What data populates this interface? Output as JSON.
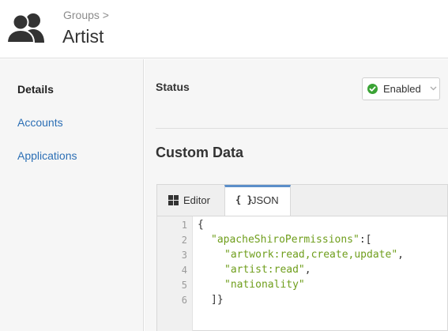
{
  "header": {
    "breadcrumb": "Groups >",
    "title": "Artist",
    "icon": "users-group-icon"
  },
  "sidebar": {
    "items": [
      {
        "label": "Details",
        "active": true
      },
      {
        "label": "Accounts",
        "active": false
      },
      {
        "label": "Applications",
        "active": false
      }
    ]
  },
  "status": {
    "label": "Status",
    "selected": "Enabled",
    "color": "#3aa335"
  },
  "custom_data": {
    "title": "Custom Data",
    "tabs": [
      {
        "label": "Editor",
        "icon": "grid-icon",
        "active": false
      },
      {
        "label": "JSON",
        "icon": "braces-icon",
        "active": true
      }
    ],
    "braces_glyph": "{ }",
    "code": {
      "line_numbers": [
        "1",
        "2",
        "3",
        "4",
        "5",
        "6"
      ],
      "open_brace": "{",
      "key": "\"apacheShiroPermissions\"",
      "key_suffix": ":[",
      "values": [
        "\"artwork:read,create,update\"",
        "\"artist:read\"",
        "\"nationality\""
      ],
      "comma": ",",
      "close": "]}"
    }
  },
  "colors": {
    "link": "#2c6fb5",
    "active_tab_accent": "#5b8ec9",
    "string": "#6f9e1c"
  }
}
